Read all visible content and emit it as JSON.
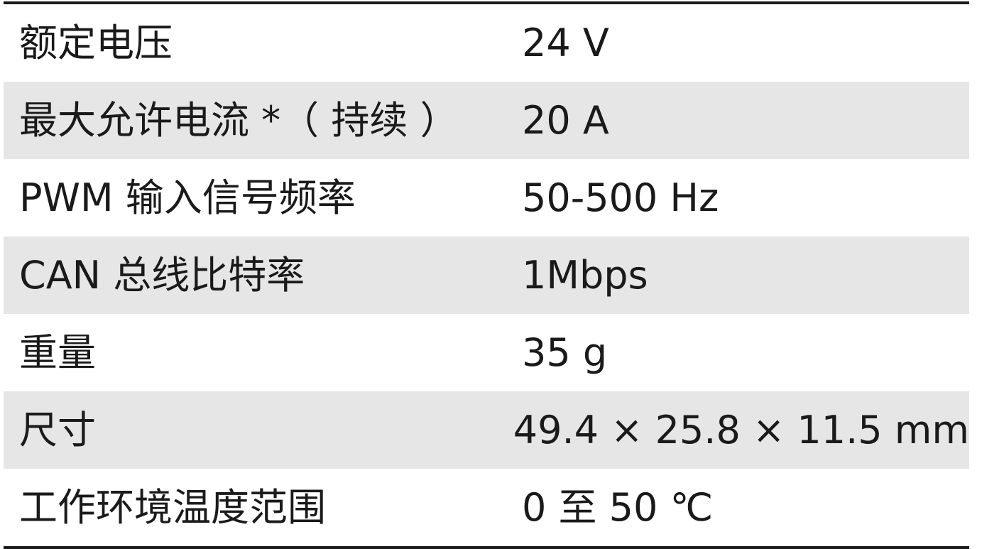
{
  "spec_table": {
    "rows": [
      {
        "label": "额定电压",
        "value": "24 V"
      },
      {
        "label": "最大允许电流 *（ 持续 ）",
        "value": "20 A"
      },
      {
        "label": "PWM 输入信号频率",
        "value": "50-500 Hz"
      },
      {
        "label": "CAN 总线比特率",
        "value": "1Mbps"
      },
      {
        "label": "重量",
        "value": "35 g"
      },
      {
        "label": "尺寸",
        "value": "49.4 × 25.8 × 11.5 mm"
      },
      {
        "label": "工作环境温度范围",
        "value": "0 至 50 ℃"
      }
    ]
  }
}
